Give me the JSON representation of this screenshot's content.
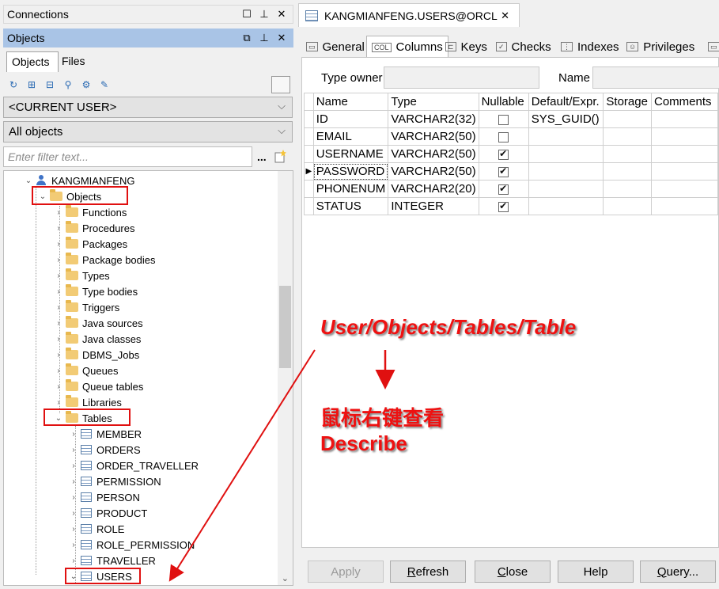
{
  "connections_panel": {
    "title": "Connections"
  },
  "objects_panel": {
    "title": "Objects",
    "tabs": [
      "Objects",
      "Files"
    ],
    "user_combo": "<CURRENT USER>",
    "type_combo": "All objects",
    "filter_placeholder": "Enter filter text...",
    "filter_dots": "..."
  },
  "tree": {
    "user": "KANGMIANFENG",
    "objects": "Objects",
    "folders": [
      "Functions",
      "Procedures",
      "Packages",
      "Package bodies",
      "Types",
      "Type bodies",
      "Triggers",
      "Java sources",
      "Java classes",
      "DBMS_Jobs",
      "Queues",
      "Queue tables",
      "Libraries"
    ],
    "tables_folder": "Tables",
    "tables": [
      "MEMBER",
      "ORDERS",
      "ORDER_TRAVELLER",
      "PERMISSION",
      "PERSON",
      "PRODUCT",
      "ROLE",
      "ROLE_PERMISSION",
      "TRAVELLER",
      "USERS"
    ]
  },
  "document_tab": {
    "title": "KANGMIANFENG.USERS@ORCL"
  },
  "subtabs": [
    "General",
    "Columns",
    "Keys",
    "Checks",
    "Indexes",
    "Privileges"
  ],
  "header_fields": {
    "type_owner_label": "Type owner",
    "name_label": "Name"
  },
  "columns_table": {
    "headers": [
      "Name",
      "Type",
      "Nullable",
      "Default/Expr.",
      "Storage",
      "Comments"
    ],
    "rows": [
      {
        "name": "ID",
        "type": "VARCHAR2(32)",
        "nullable": false,
        "default": "SYS_GUID()"
      },
      {
        "name": "EMAIL",
        "type": "VARCHAR2(50)",
        "nullable": false,
        "default": ""
      },
      {
        "name": "USERNAME",
        "type": "VARCHAR2(50)",
        "nullable": true,
        "default": ""
      },
      {
        "name": "PASSWORD",
        "type": "VARCHAR2(50)",
        "nullable": true,
        "default": ""
      },
      {
        "name": "PHONENUM",
        "type": "VARCHAR2(20)",
        "nullable": true,
        "default": ""
      },
      {
        "name": "STATUS",
        "type": "INTEGER",
        "nullable": true,
        "default": ""
      }
    ]
  },
  "buttons": {
    "apply": "Apply",
    "refresh": "Refresh",
    "close": "Close",
    "help": "Help",
    "query": "Query..."
  },
  "annotations": {
    "path": "User/Objects/Tables/Table",
    "line1": "鼠标右键查看",
    "line2": "Describe",
    "color": "#e01010"
  }
}
